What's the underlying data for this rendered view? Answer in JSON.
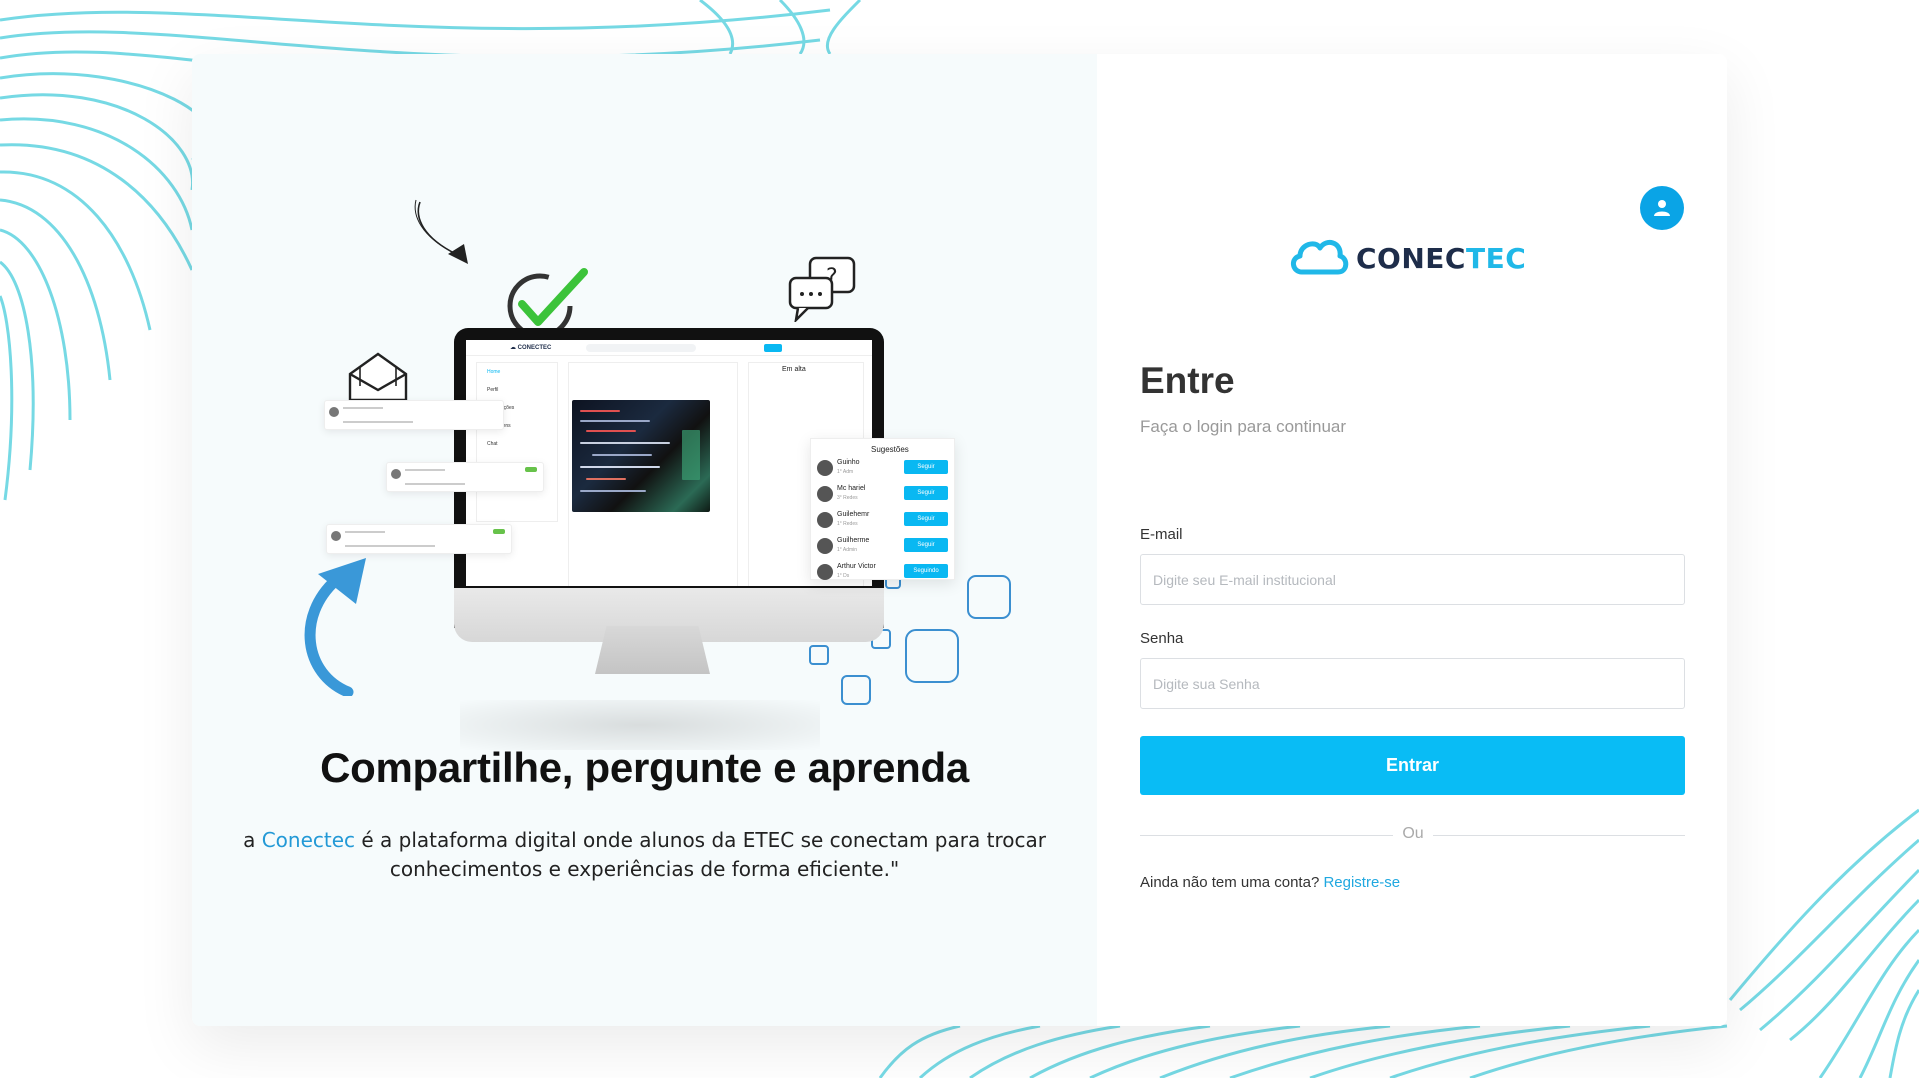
{
  "brand": {
    "name_part1": "CONEC",
    "name_part2": "TEC",
    "primary_color": "#09bcf5",
    "dark_color": "#1e2d4a"
  },
  "hero": {
    "title": "Compartilhe, pergunte e aprenda",
    "desc_prefix": "a ",
    "desc_link": "Conectec",
    "desc_rest": " é a plataforma digital onde alunos da ETEC se conectam para trocar conhecimentos e experiências de forma eficiente.\""
  },
  "illustration": {
    "sidebar_items": [
      "Home",
      "Perfil",
      "Notificações",
      "Postagens",
      "Chat"
    ],
    "trending_title": "Em alta",
    "suggestions_title": "Sugestões",
    "suggestions": [
      {
        "name": "Guinho",
        "sub": "1° Adm",
        "action": "Seguir"
      },
      {
        "name": "Mc hariel",
        "sub": "3° Redes",
        "action": "Seguir"
      },
      {
        "name": "Guilehemr",
        "sub": "1° Redes",
        "action": "Seguir"
      },
      {
        "name": "Guilherme",
        "sub": "1° Admin",
        "action": "Seguir"
      },
      {
        "name": "Arthur Victor",
        "sub": "1° Ds",
        "action": "Seguindo"
      }
    ]
  },
  "login": {
    "title": "Entre",
    "subtitle": "Faça o login para continuar",
    "email_label": "E-mail",
    "email_placeholder": "Digite seu E-mail institucional",
    "email_value": "",
    "password_label": "Senha",
    "password_placeholder": "Digite sua Senha",
    "password_value": "",
    "submit_label": "Entrar",
    "divider_text": "Ou",
    "signup_prompt": "Ainda não tem uma conta? ",
    "signup_link": "Registre-se"
  },
  "icons": {
    "user_button": "user-icon",
    "logo": "cloud-icon"
  }
}
